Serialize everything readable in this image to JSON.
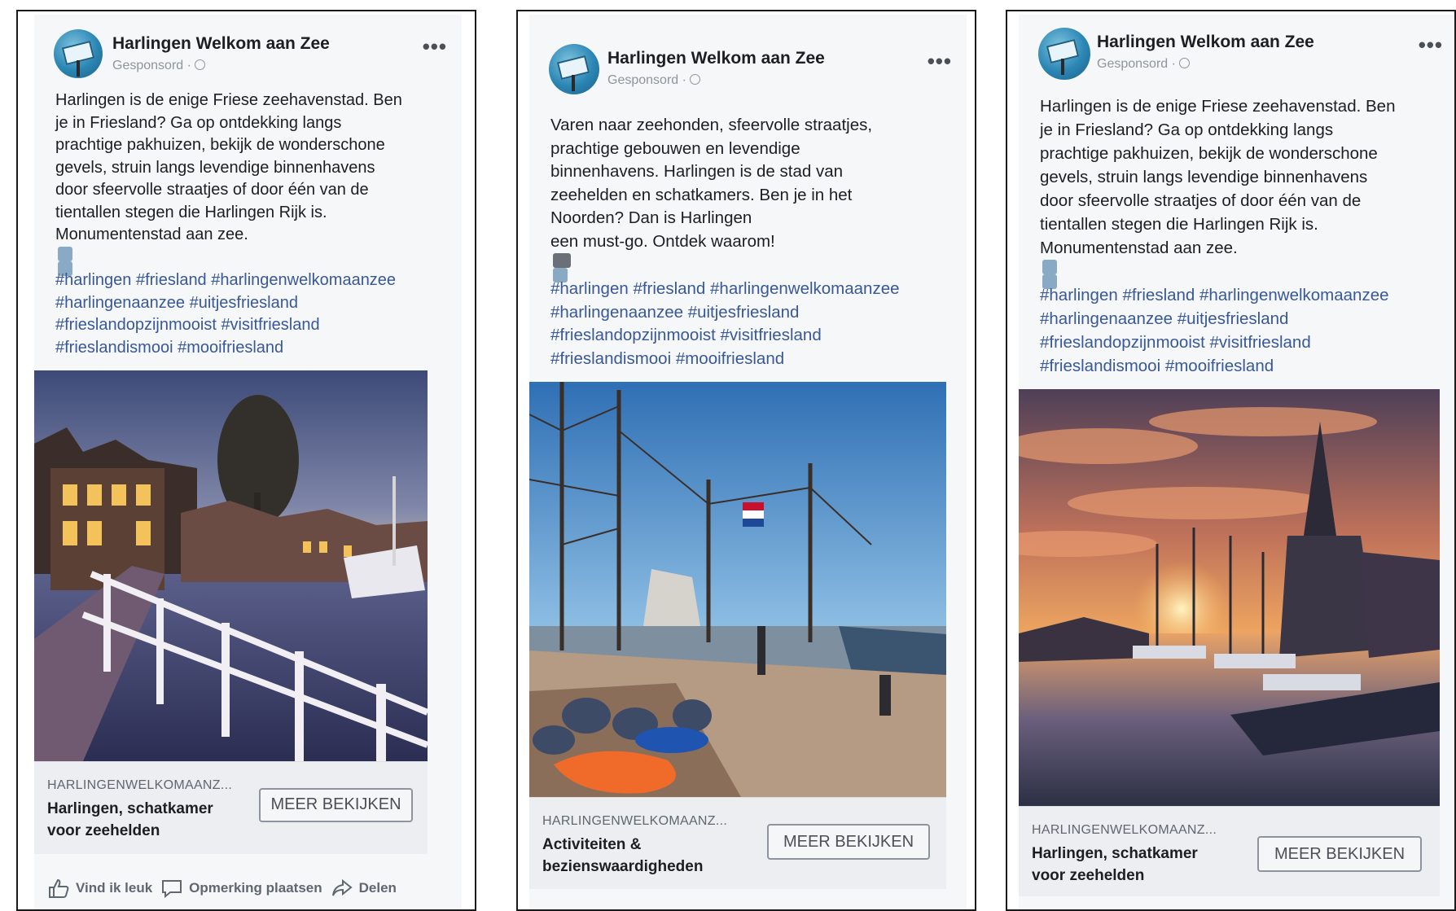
{
  "page_name": "Harlingen Welkom aan Zee",
  "sponsored": "Gesponsord ·",
  "more": "•••",
  "tags": [
    "#harlingen #friesland #harlingenwelkomaanzee",
    "#harlingenaanzee #uitjesfriesland",
    "#frieslandopzijnmooist #visitfriesland",
    "#frieslandismooi #mooifriesland"
  ],
  "cta_button": "MEER BEKIJKEN",
  "ads": [
    {
      "text_lines": [
        "Harlingen is de enige Friese zeehavenstad. Ben",
        "je in Friesland? Ga op ontdekking langs",
        "prachtige pakhuizen, bekijk de wonderschone",
        "gevels, struin langs levendige binnenhavens",
        "door sfeervolle straatjes of door één van de",
        "tientallen stegen die Harlingen Rijk is.",
        "Monumentenstad aan zee."
      ],
      "domain": "HARLINGENWELKOMAANZ...",
      "title_lines": [
        "Harlingen, schatkamer",
        "voor zeehelden"
      ]
    },
    {
      "text_lines": [
        "Varen naar zeehonden, sfeervolle straatjes,",
        "prachtige gebouwen en levendige",
        "binnenhavens. Harlingen is de stad van",
        "zeehelden en schatkamers. Ben je in het",
        "Noorden? Dan is Harlingen",
        "een must-go. Ontdek waarom!"
      ],
      "domain": "HARLINGENWELKOMAANZ...",
      "title_lines": [
        "Activiteiten &",
        "bezienswaardigheden"
      ]
    },
    {
      "text_lines": [
        "Harlingen is de enige Friese zeehavenstad. Ben",
        "je in Friesland? Ga op ontdekking langs",
        "prachtige pakhuizen, bekijk de wonderschone",
        "gevels, struin langs levendige binnenhavens",
        "door sfeervolle straatjes of door één van de",
        "tientallen stegen die Harlingen Rijk is.",
        "Monumentenstad aan zee."
      ],
      "domain": "HARLINGENWELKOMAANZ...",
      "title_lines": [
        "Harlingen, schatkamer",
        "voor zeehelden"
      ]
    }
  ],
  "actions": {
    "like": "Vind ik leuk",
    "comment": "Opmerking plaatsen",
    "share": "Delen"
  }
}
